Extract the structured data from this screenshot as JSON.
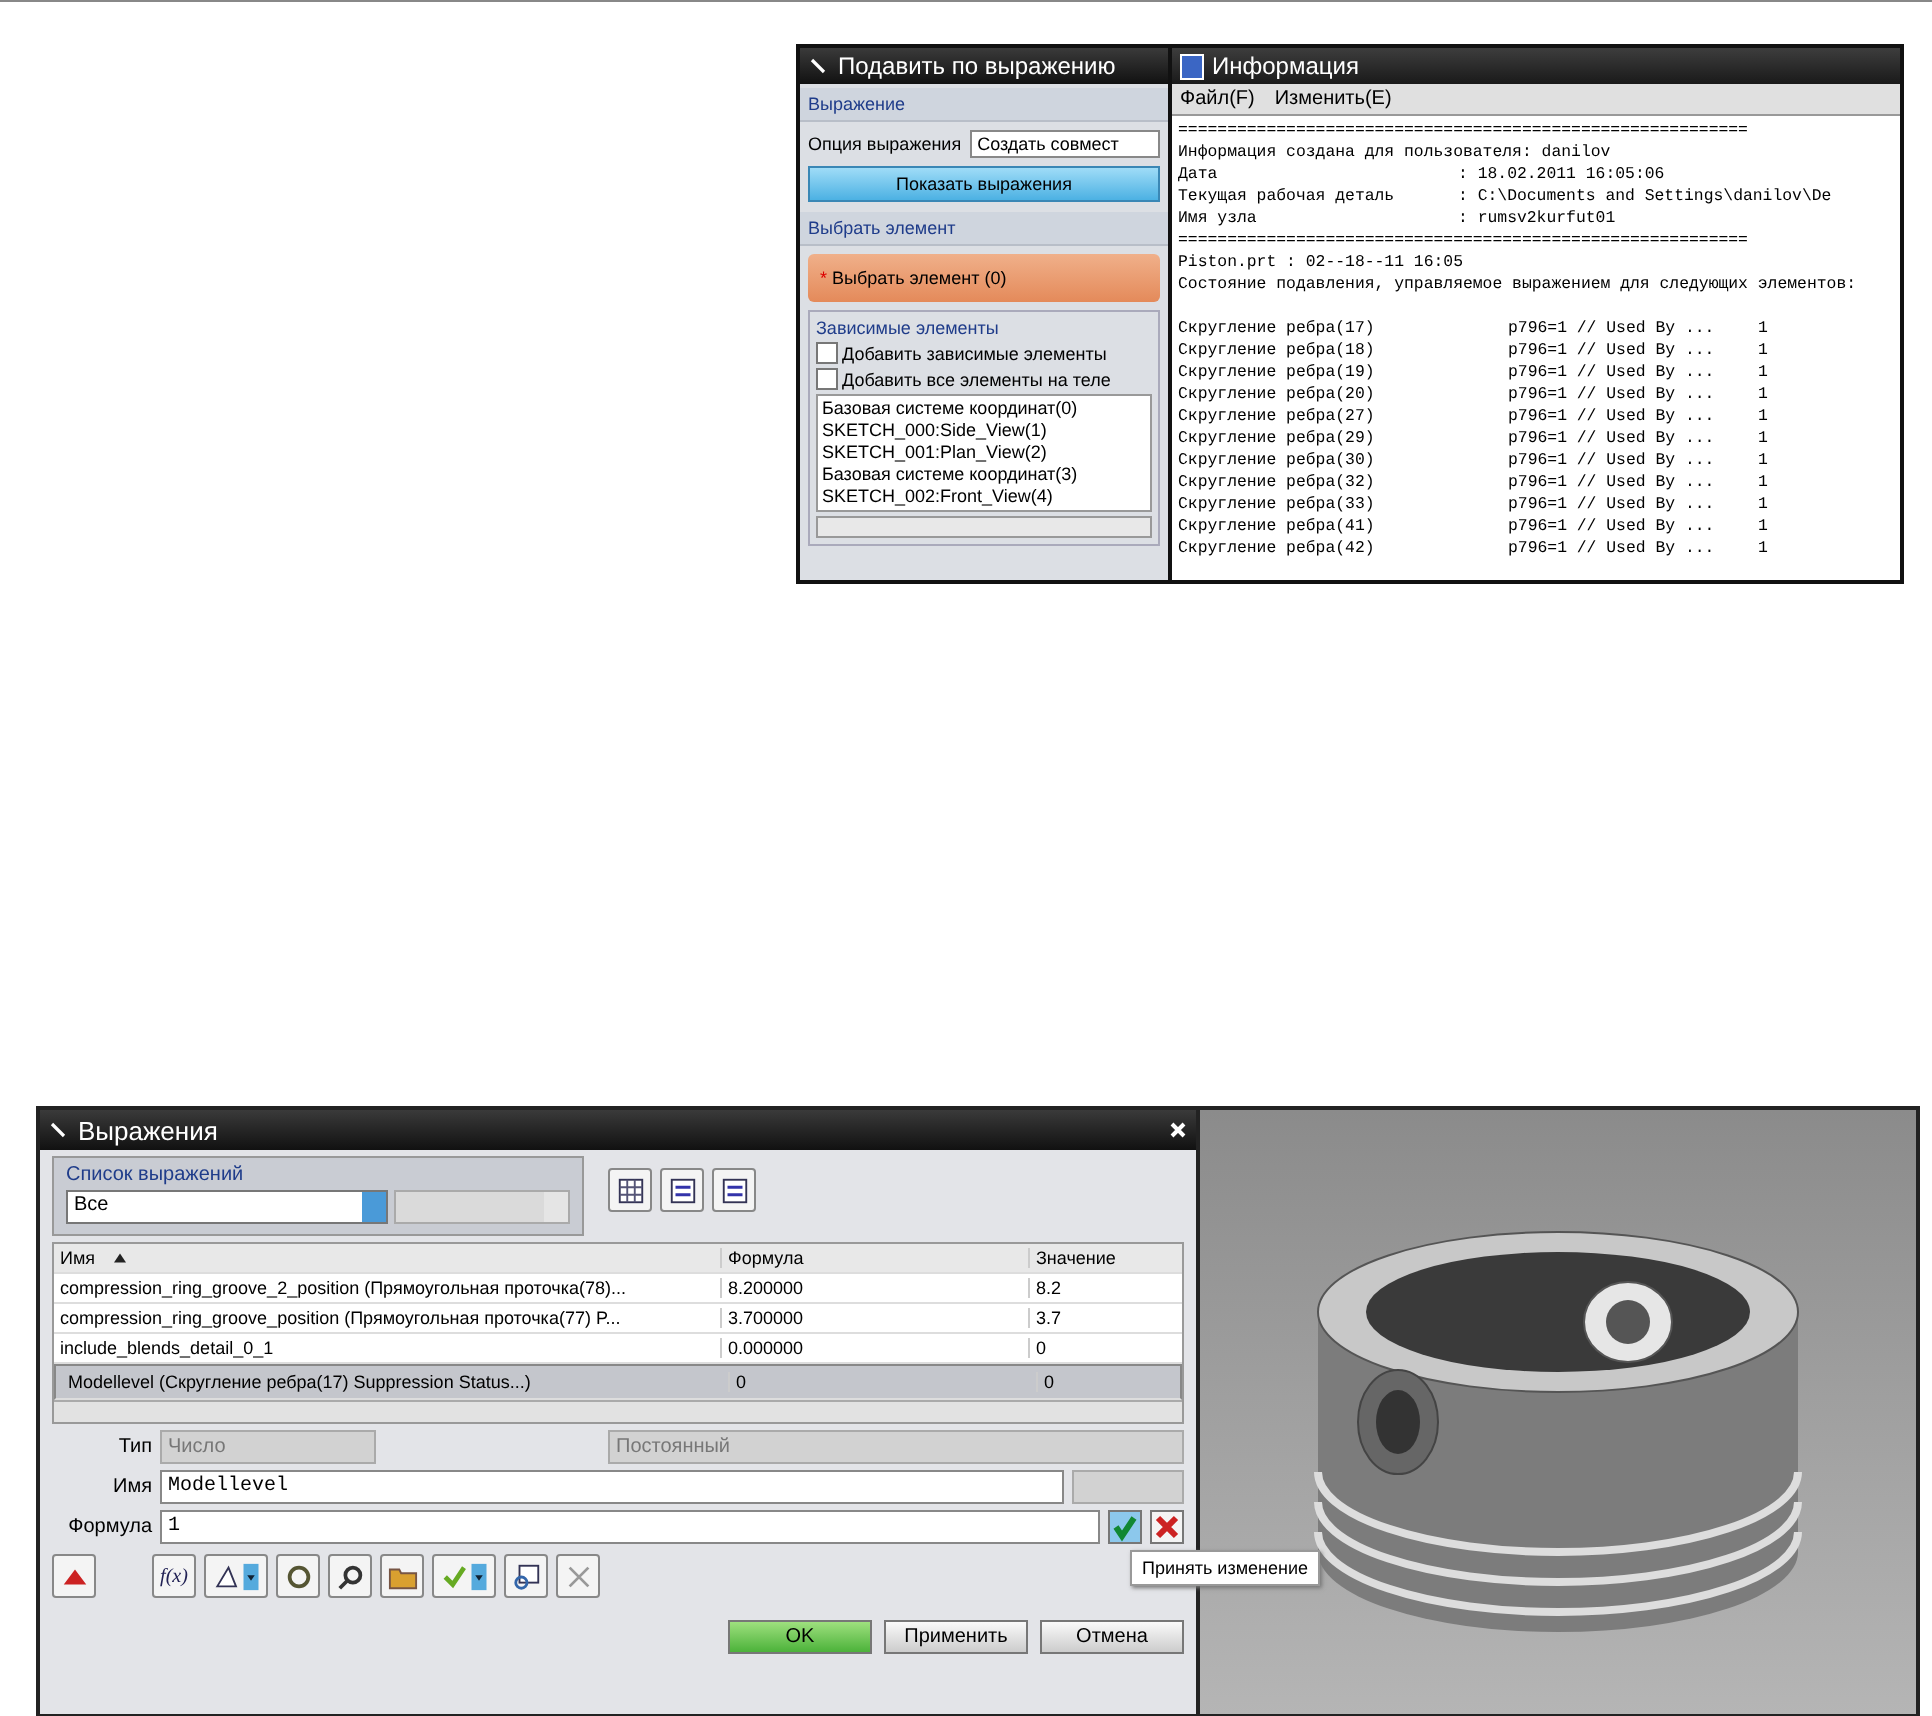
{
  "suppress_dialog": {
    "title": "Подавить по выражению",
    "expression_section": "Выражение",
    "option_label": "Опция выражения",
    "option_value": "Создать совмест",
    "show_button": "Показать выражения",
    "select_section": "Выбрать элемент",
    "select_element": "Выбрать элемент (0)",
    "required_mark": "*",
    "dependent_group": "Зависимые элементы",
    "checkboxes": [
      {
        "label": "Добавить зависимые элементы",
        "checked": false
      },
      {
        "label": "Добавить все элементы на теле",
        "checked": false
      }
    ],
    "items": [
      "Базовая системе координат(0)",
      "SKETCH_000:Side_View(1)",
      "SKETCH_001:Plan_View(2)",
      "Базовая системе координат(3)",
      "SKETCH_002:Front_View(4)"
    ]
  },
  "info_window": {
    "title": "Информация",
    "menu": [
      "Файл(F)",
      "Изменить(E)"
    ],
    "lines": [
      {
        "kind": "rule",
        "text": "=========================================================="
      },
      {
        "kind": "text",
        "text": "Информация создана для пользователя: danilov"
      },
      {
        "kind": "field",
        "label": "Дата",
        "value": ": 18.02.2011 16:05:06"
      },
      {
        "kind": "field",
        "label": "Текущая рабочая деталь",
        "value": ": C:\\Documents and Settings\\danilov\\De"
      },
      {
        "kind": "field",
        "label": "Имя узла",
        "value": ": rumsv2kurfut01"
      },
      {
        "kind": "rule",
        "text": "=========================================================="
      },
      {
        "kind": "text",
        "text": "Piston.prt : 02--18--11 16:05"
      },
      {
        "kind": "text",
        "text": "Состояние подавления, управляемое выражением для следующих элементов:"
      }
    ],
    "rows": [
      {
        "name": "Скругление ребра(17)",
        "formula": "p796=1 // Used By ...",
        "value": "1"
      },
      {
        "name": "Скругление ребра(18)",
        "formula": "p796=1 // Used By ...",
        "value": "1"
      },
      {
        "name": "Скругление ребра(19)",
        "formula": "p796=1 // Used By ...",
        "value": "1"
      },
      {
        "name": "Скругление ребра(20)",
        "formula": "p796=1 // Used By ...",
        "value": "1"
      },
      {
        "name": "Скругление ребра(27)",
        "formula": "p796=1 // Used By ...",
        "value": "1"
      },
      {
        "name": "Скругление ребра(29)",
        "formula": "p796=1 // Used By ...",
        "value": "1"
      },
      {
        "name": "Скругление ребра(30)",
        "formula": "p796=1 // Used By ...",
        "value": "1"
      },
      {
        "name": "Скругление ребра(32)",
        "formula": "p796=1 // Used By ...",
        "value": "1"
      },
      {
        "name": "Скругление ребра(33)",
        "formula": "p796=1 // Used By ...",
        "value": "1"
      },
      {
        "name": "Скругление ребра(41)",
        "formula": "p796=1 // Used By ...",
        "value": "1"
      },
      {
        "name": "Скругление ребра(42)",
        "formula": "p796=1 // Used By ...",
        "value": "1"
      }
    ]
  },
  "expressions_dialog": {
    "title": "Выражения",
    "list_group": "Список выражений",
    "list_filter": "Все",
    "columns": [
      "Имя",
      "Формула",
      "Значение"
    ],
    "rows": [
      {
        "name": "compression_ring_groove_2_position  (Прямоугольная проточка(78)...",
        "formula": "8.200000",
        "value": "8.2",
        "selected": false
      },
      {
        "name": "compression_ring_groove_position  (Прямоугольная проточка(77) P...",
        "formula": "3.700000",
        "value": "3.7",
        "selected": false
      },
      {
        "name": "include_blends_detail_0_1",
        "formula": "0.000000",
        "value": "0",
        "selected": false
      },
      {
        "name": "Modellevel  (Скругление ребра(17) Suppression Status...)",
        "formula": "0",
        "value": "0",
        "selected": true
      }
    ],
    "type_label": "Тип",
    "type_value": "Число",
    "type_mode": "Постоянный",
    "name_label": "Имя",
    "name_value": "Modellevel",
    "formula_label": "Формула",
    "formula_value": "1",
    "function_button": "f(x)",
    "tooltip": "Принять изменение",
    "buttons": [
      "OK",
      "Применить",
      "Отмена"
    ]
  }
}
